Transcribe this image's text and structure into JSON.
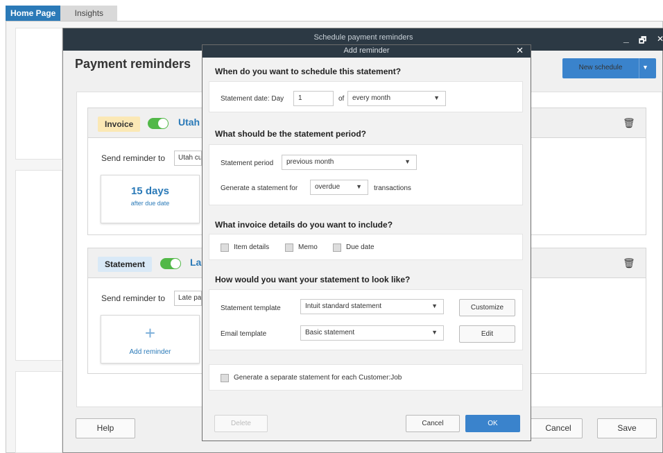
{
  "tabs": {
    "home": "Home Page",
    "insights": "Insights"
  },
  "window": {
    "title": "Schedule payment reminders",
    "minimize": "_",
    "restore": "🗗",
    "close": "✕"
  },
  "main": {
    "title": "Payment reminders",
    "new_schedule": "New schedule",
    "new_schedule_caret": "▼"
  },
  "cards": [
    {
      "badge": "Invoice",
      "badge_color": "#fbe8b5",
      "customer": "Utah",
      "send_label": "Send reminder to",
      "send_value": "Utah cu",
      "tile_big": "15 days",
      "tile_small": "after due date"
    },
    {
      "badge": "Statement",
      "badge_color": "#d9e9f7",
      "customer": "La",
      "send_label": "Send reminder to",
      "send_value": "Late pa",
      "add_label": "Add reminder",
      "add_plus": "+"
    }
  ],
  "footer": {
    "help": "Help",
    "cancel": "Cancel",
    "save": "Save"
  },
  "dialog": {
    "subtitle": "Add reminder",
    "close": "✕",
    "q1": "When do you want to schedule this statement?",
    "statement_date_label": "Statement date: Day",
    "day_value": "1",
    "of_label": "of",
    "frequency": "every month",
    "q2": "What should be the statement period?",
    "period_label": "Statement period",
    "period_value": "previous month",
    "generate_label": "Generate a statement for",
    "generate_value": "overdue",
    "transactions_label": "transactions",
    "q3": "What invoice details do you want to include?",
    "details": [
      "Item details",
      "Memo",
      "Due date"
    ],
    "q4": "How would you want your statement to look like?",
    "template_label": "Statement template",
    "template_value": "Intuit standard statement",
    "customize": "Customize",
    "email_label": "Email template",
    "email_value": "Basic statement",
    "edit": "Edit",
    "separate_label": "Generate a separate statement for each Customer:Job",
    "delete": "Delete",
    "cancel": "Cancel",
    "ok": "OK"
  },
  "colors": {
    "accent": "#3a83cc",
    "toggle_on": "#52b848",
    "titlebar": "#2c3944"
  }
}
